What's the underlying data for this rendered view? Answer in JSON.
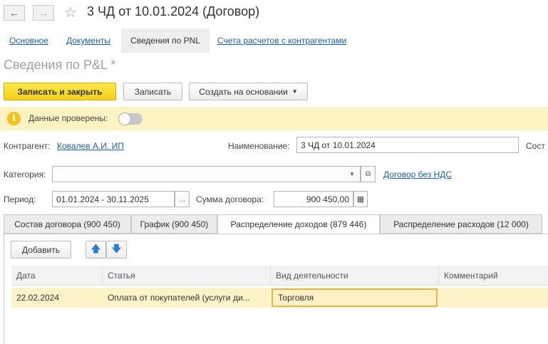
{
  "header": {
    "title": "3 ЧД от 10.01.2024 (Договор)"
  },
  "sections": {
    "tab1": "Основное",
    "tab2": "Документы",
    "tab3": "Сведения по PNL",
    "tab4": "Счета расчетов с контрагентами"
  },
  "form": {
    "title": "Сведения по P&L *"
  },
  "toolbar": {
    "save_close": "Записать и закрыть",
    "save": "Записать",
    "create_based": "Создать на основании"
  },
  "info": {
    "checked_label": "Данные проверены:",
    "checked": false
  },
  "fields": {
    "contractor_label": "Контрагент:",
    "contractor_value": "Ковалев А.И. ИП",
    "name_label": "Наименование:",
    "name_value": "3 ЧД от 10.01.2024",
    "cut_label": "Сост",
    "category_label": "Категория:",
    "category_value": "",
    "contract_link": "Договор без НДС",
    "period_label": "Период:",
    "period_value": "01.01.2024 - 30.11.2025",
    "sum_label": "Сумма договора:",
    "sum_value": "900 450,00"
  },
  "tabs": {
    "t1": "Состав договора (900 450)",
    "t2": "График (900 450)",
    "t3": "Распределение доходов (879 446)",
    "t4": "Распределение расходов (12 000)"
  },
  "table_toolbar": {
    "add": "Добавить"
  },
  "table": {
    "columns": {
      "date": "Дата",
      "item": "Статья",
      "activity": "Вид деятельности",
      "comment": "Комментарий"
    },
    "rows": [
      {
        "date": "22.02.2024",
        "item": "Оплата от покупателей (услуги ди...",
        "activity": "Торговля",
        "comment": ""
      }
    ]
  }
}
